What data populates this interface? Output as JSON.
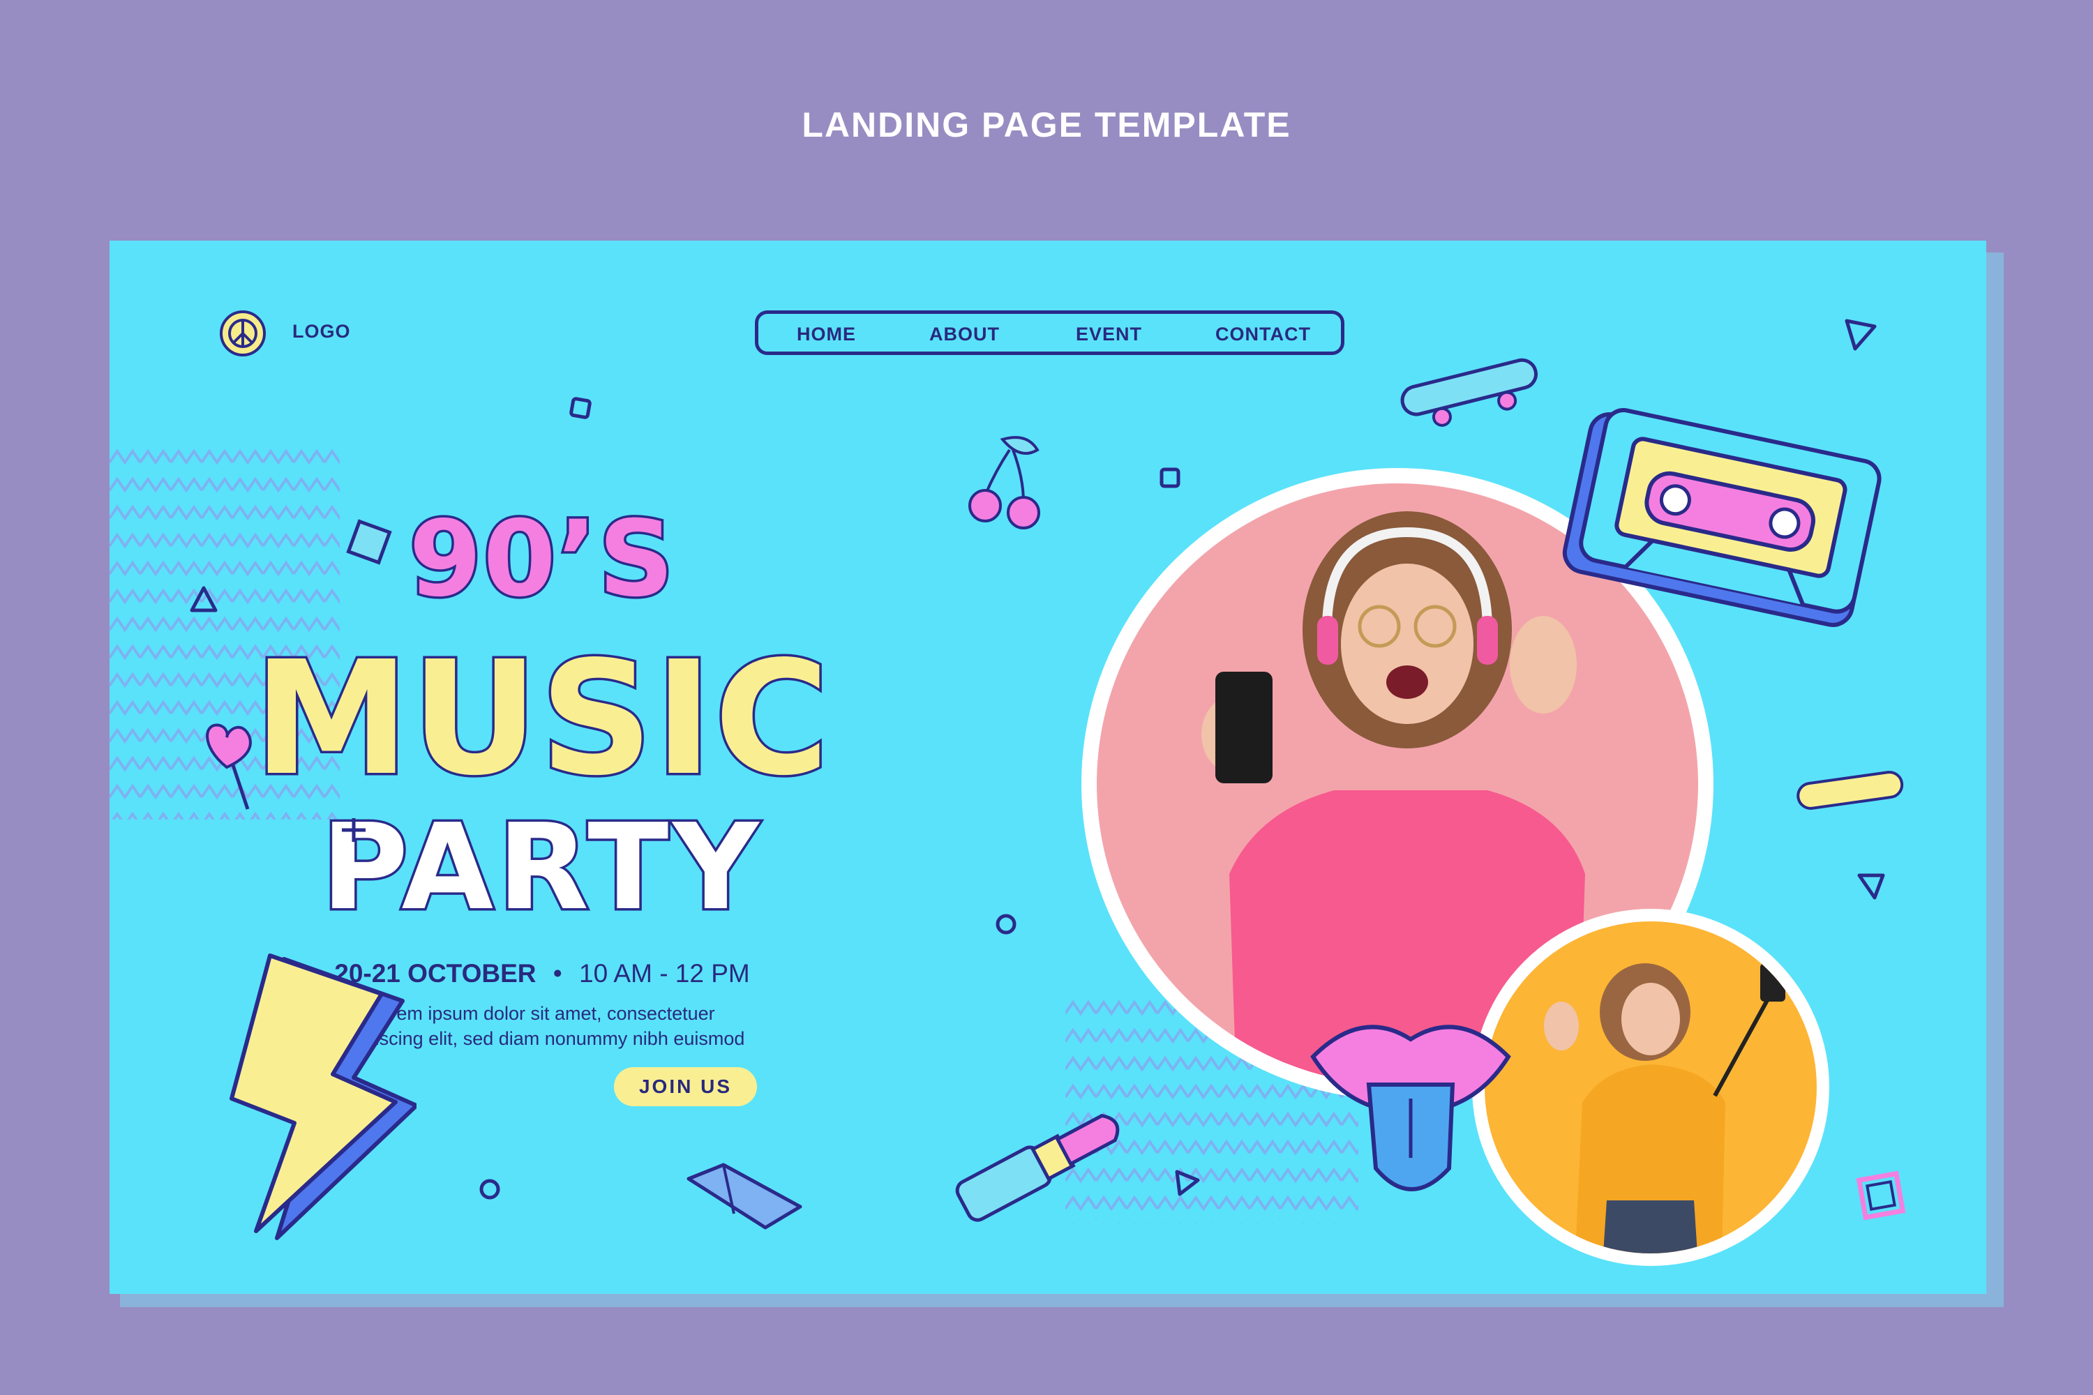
{
  "caption": "LANDING PAGE TEMPLATE",
  "header": {
    "logo_label": "LOGO",
    "nav": [
      {
        "label": "HOME"
      },
      {
        "label": "ABOUT"
      },
      {
        "label": "EVENT"
      },
      {
        "label": "CONTACT"
      }
    ]
  },
  "hero": {
    "title_line1": "90’S",
    "title_line2": "MUSIC",
    "title_line3": "PARTY",
    "date": "20-21 OCTOBER",
    "separator": "•",
    "time": "10 AM - 12 PM",
    "description_line1": "Lorem ipsum dolor sit amet, consectetuer",
    "description_line2": "adipiscing elit, sed diam nonummy nibh euismod",
    "cta_label": "JOIN US"
  },
  "colors": {
    "page_background": "#978dc2",
    "hero_background": "#5ae2fa",
    "navy": "#29297e",
    "pink": "#f57fe0",
    "yellow": "#f9ef92",
    "photo1_background": "#f3a4ab",
    "photo2_background": "#fdb535"
  },
  "icons": [
    "peace-icon",
    "skateboard-icon",
    "cassette-icon",
    "cherry-icon",
    "lollipop-icon",
    "lightning-icon",
    "lipstick-icon",
    "crystal-icon",
    "lips-icon"
  ]
}
